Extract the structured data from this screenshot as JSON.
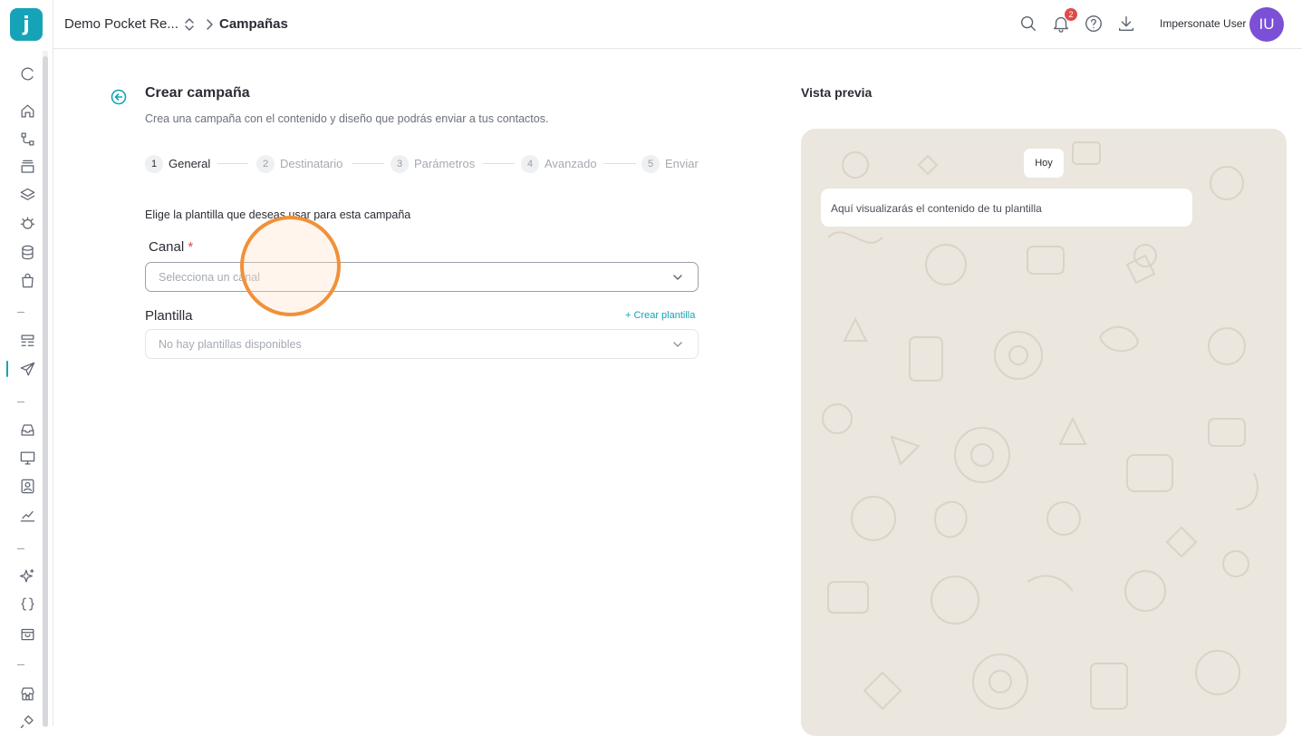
{
  "app": {
    "logo_letter": "j",
    "brand_color": "#16a3b7"
  },
  "breadcrumb": {
    "workspace": "Demo Pocket Re...",
    "current": "Campañas"
  },
  "topbar": {
    "notifications_count": "2",
    "user_name": "Impersonate User",
    "avatar_initials": "IU",
    "avatar_color": "#7b4fd6"
  },
  "sidebar": {
    "active_item": "campaigns",
    "icons": [
      "refresh-icon",
      "home-icon",
      "flows-icon",
      "archive-icon",
      "layers-icon",
      "bug-icon",
      "database-icon",
      "bag-icon",
      "list-icon",
      "send-icon",
      "inbox-icon",
      "monitor-icon",
      "contacts-icon",
      "chart-icon",
      "sparkles-icon",
      "braces-icon",
      "shop-bag-icon",
      "store-icon",
      "plug-icon"
    ]
  },
  "page": {
    "title": "Crear campaña",
    "subtitle": "Crea una campaña con el contenido y diseño que podrás enviar a tus contactos.",
    "steps": [
      {
        "num": "1",
        "label": "General",
        "active": true
      },
      {
        "num": "2",
        "label": "Destinatario",
        "active": false
      },
      {
        "num": "3",
        "label": "Parámetros",
        "active": false
      },
      {
        "num": "4",
        "label": "Avanzado",
        "active": false
      },
      {
        "num": "5",
        "label": "Enviar",
        "active": false
      }
    ],
    "choose_label": "Elige la plantilla que deseas usar para esta campaña",
    "canal": {
      "label": "Canal",
      "required_mark": "*",
      "placeholder": "Selecciona un canal"
    },
    "plantilla": {
      "label": "Plantilla",
      "create_link": "+ Crear plantilla",
      "placeholder": "No hay plantillas disponibles"
    }
  },
  "preview": {
    "title": "Vista previa",
    "date_chip": "Hoy",
    "message": "Aquí visualizarás el contenido de tu plantilla",
    "background_color": "#ebe6de"
  }
}
